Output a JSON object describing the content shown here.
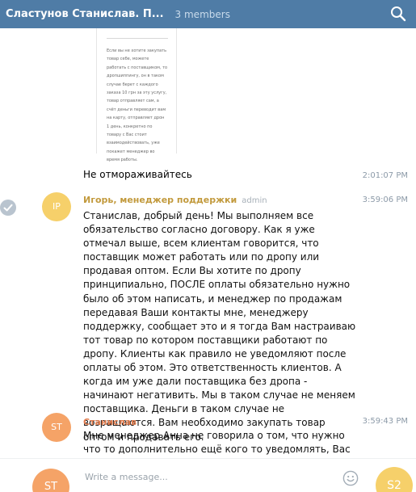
{
  "header": {
    "title": "Сластунов Станислав. П...",
    "members": "3 members"
  },
  "document_preview": {
    "text": "Если вы не хотите закупать товар себе, можете работать с поставщиком, то дропшиппингу, он в таком случае берет с каждого заказа 10 грн за эту услугу, товар отправляет сам, а счёт деньги переводит вам на карту, отправляет дрон 1 день, конкретно по товару с Вас стоит взаимодействовать, уже покажет менеджер во время работы."
  },
  "messages": [
    {
      "text": "Не отмораживайтесь",
      "time": "2:01:07 PM"
    },
    {
      "avatar": "IP",
      "author": "Игорь, менеджер поддержки",
      "badge": "admin",
      "time": "3:59:06 PM",
      "text": "Станислав, добрый день! Мы выполняем все обязательство согласно договору.  Как я уже отмечал выше, всем клиентам говорится, что поставщик может работать или по дропу или продавая оптом. Если Вы хотите по дропу принципиально, ПОСЛЕ оплаты обязательно нужно было об этом написать, и менеджер по продажам передавая Ваши контакты мне, менеджеру поддержку, сообщает это и я тогда Вам настраиваю тот товар по котором поставщики работают по дропу. Клиенты как правило не уведомляют после оплаты об этом. Это ответственность клиентов. А когда им уже дали поставщика без дропа - начинают негативить. Мы в таком случае не меняем поставщика. Деньги в таком случае не возращаются. Вам необходимо закупать товар оптом и продавать его."
    },
    {
      "avatar": "ST",
      "author": "Станислав",
      "time": "3:59:43 PM",
      "text": "Мне менеджер Анна не говорила о том, что нужно что то дополнительно ещё кого то уведомлять, Вас я уведомил сразу как что Вы мне сообщили, что товар под выкуп. А за такие"
    }
  ],
  "composer": {
    "placeholder": "Write a message...",
    "left_avatar": "ST",
    "right_avatar": "S2"
  },
  "colors": {
    "header_bg": "#4f7ca6",
    "admin_name": "#c29a3d",
    "user_name": "#e17c4e",
    "avatar_yellow": "#f6d06a",
    "avatar_orange": "#f5a367"
  }
}
